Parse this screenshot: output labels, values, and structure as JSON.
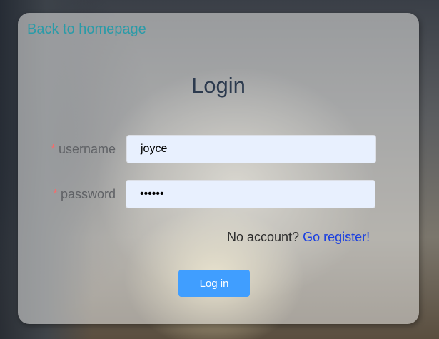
{
  "header": {
    "back_link": "Back to homepage"
  },
  "form": {
    "title": "Login",
    "required_mark": "*",
    "username": {
      "label": "username",
      "value": "joyce"
    },
    "password": {
      "label": "password",
      "value": "••••••"
    },
    "register": {
      "prompt": "No account?",
      "link": "Go register!"
    },
    "submit_label": "Log in"
  },
  "colors": {
    "accent": "#409eff",
    "link": "#2a9ba8",
    "register_link": "#1a3fe0",
    "required": "#f56c6c",
    "input_bg": "#e8f0fe"
  }
}
